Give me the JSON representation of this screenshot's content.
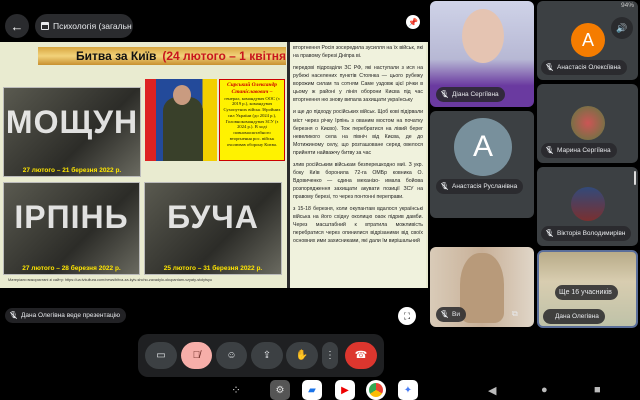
{
  "header": {
    "back_icon": "arrow-left-icon",
    "meeting_title": "Психологія (загальн",
    "pin_icon": "pin-icon"
  },
  "status_bar": {
    "battery": "94%"
  },
  "slide": {
    "title": "Битва за Київ",
    "title_dates": "(24 лютого – 1 квітня",
    "photos": [
      {
        "word": "МОЩУН",
        "caption": "27 лютого – 21 березня 2022 р."
      },
      {
        "word": "ІРПІНЬ",
        "caption": "27 лютого – 28 березня 2022 р."
      },
      {
        "word": "БУЧА",
        "caption": "25 лютого – 31 березня 2022 р."
      }
    ],
    "general_name": "Сирський Олександр Станіславович –",
    "general_text": "генерал, командувач ООС (з 2019 р.), командувач Сухопутних військ Збройних сил України (до 2024 р.), Головнокомандувач ЗСУ (з 2024 р.). В ході повномасштабного вторгнення рос. військ очолював оборону Києва.",
    "text_paragraphs": [
      "вторгнення Росія зосередила зусилля на їх військ, які на правому березі Дніпра ві.",
      "передові підрозділи ЗС РФ, які наступали з ися на рубежі населених пунктів Стоянка — цього рубежу ворожим силам та сотням Саме уздовж цієї річки в цьому ж районі у лінія оборони Києва під час вторгнення ню знову випала захищати українську",
      "и ще до підходу російських військ. Щоб кові підірвали міст через річку Ірпінь з ованим мостом на початку березня о Києво). Тож перебратися на лівий берег невеликого села на північ від Києва, де до Мотижиному селу, що розташоване серед овелося прийняти найважчу битву за час",
      "злив російським військам безперешкодно миї. З укр. боку Київ боронила 72-га ОМБр ковника О. Вдовиченко — єдина механізо- имала бойова розпорядження захищати акувати позиції ЗСУ на правому березі, то через понтонні переправи.",
      "з 15-18 березня, коли окупантам вдалося українські війська на його східну околицю оаок підрив дамби. Через масштабний к втратила можливість перебратися через опинилися відрізаними від своїх основних ими захисниками, які дали їм вирішальний"
    ],
    "source": "Матеріали використані зі сайту: https://ua.tvkultura.com/news/bitva-za-kyiv-shcho-zavadylo-okupantam-vzyaty-stolytsyu"
  },
  "presenter_label": "Дана Олегівна веде презентацію",
  "fullscreen_icon": "fullscreen-icon",
  "participants": [
    {
      "name": "Діана Сергіївна",
      "muted": true
    },
    {
      "name": "Анастасія Олексіївна",
      "initial": "A",
      "avatar_color": "#f57c00",
      "muted": true
    },
    {
      "name": "Марина Сергіївна",
      "muted": true
    },
    {
      "name": "Анастасія Русланівна",
      "initial": "A",
      "avatar_color": "#78909c",
      "muted": true
    },
    {
      "name": "Вікторія Володимирівн",
      "muted": true
    },
    {
      "name": "Ви",
      "muted": true
    },
    {
      "name": "Дана Олегівна",
      "muted": false
    }
  ],
  "more_participants": "Ще 16 учасників",
  "controls": {
    "camera": "camera-icon",
    "mic": "mic-off-icon",
    "mic_color": "#f6aea9",
    "emoji": "emoji-icon",
    "present": "present-icon",
    "hand": "raise-hand-icon",
    "more": "more-vert-icon",
    "end": "end-call-icon",
    "end_color": "#dc362e"
  },
  "taskbar": [
    "apps-icon",
    "settings-icon",
    "files-icon",
    "youtube-icon",
    "chrome-icon",
    "gemini-icon"
  ],
  "nav": [
    "back-icon",
    "home-icon",
    "recents-icon"
  ]
}
